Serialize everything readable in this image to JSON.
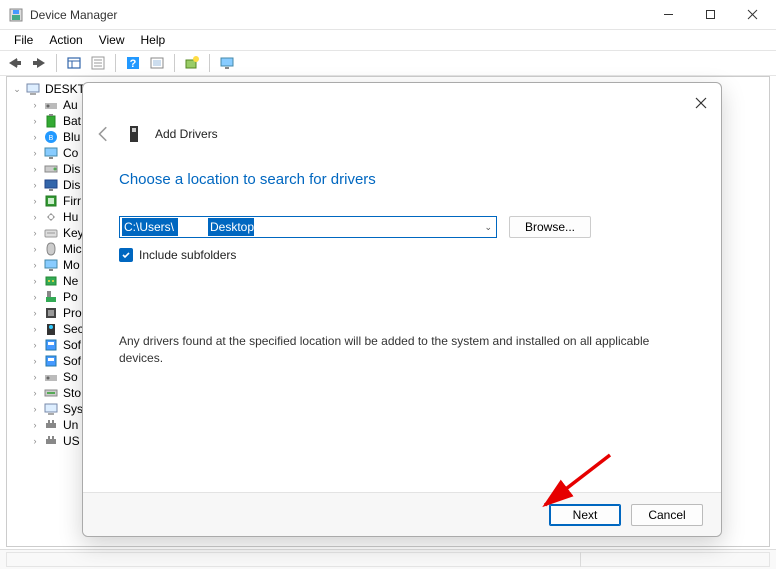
{
  "window": {
    "title": "Device Manager"
  },
  "menu": {
    "file": "File",
    "action": "Action",
    "view": "View",
    "help": "Help"
  },
  "tree": {
    "root": "DESKTO",
    "items": [
      "Au",
      "Bat",
      "Blu",
      "Co",
      "Dis",
      "Dis",
      "Firr",
      "Hu",
      "Key",
      "Mic",
      "Mo",
      "Ne",
      "Po",
      "Pro",
      "Sec",
      "Sof",
      "Sof",
      "So",
      "Sto",
      "Sys",
      "Un",
      "US"
    ]
  },
  "dialog": {
    "header": "Add Drivers",
    "title": "Choose a location to search for drivers",
    "path_full": "C:\\Users\\        \\Desktop",
    "path_part1": "C:\\Users\\",
    "path_part2": "Desktop",
    "browse": "Browse...",
    "include_subfolders": "Include subfolders",
    "info": "Any drivers found at the specified location will be added to the system and installed on all applicable devices.",
    "next": "Next",
    "cancel": "Cancel"
  }
}
